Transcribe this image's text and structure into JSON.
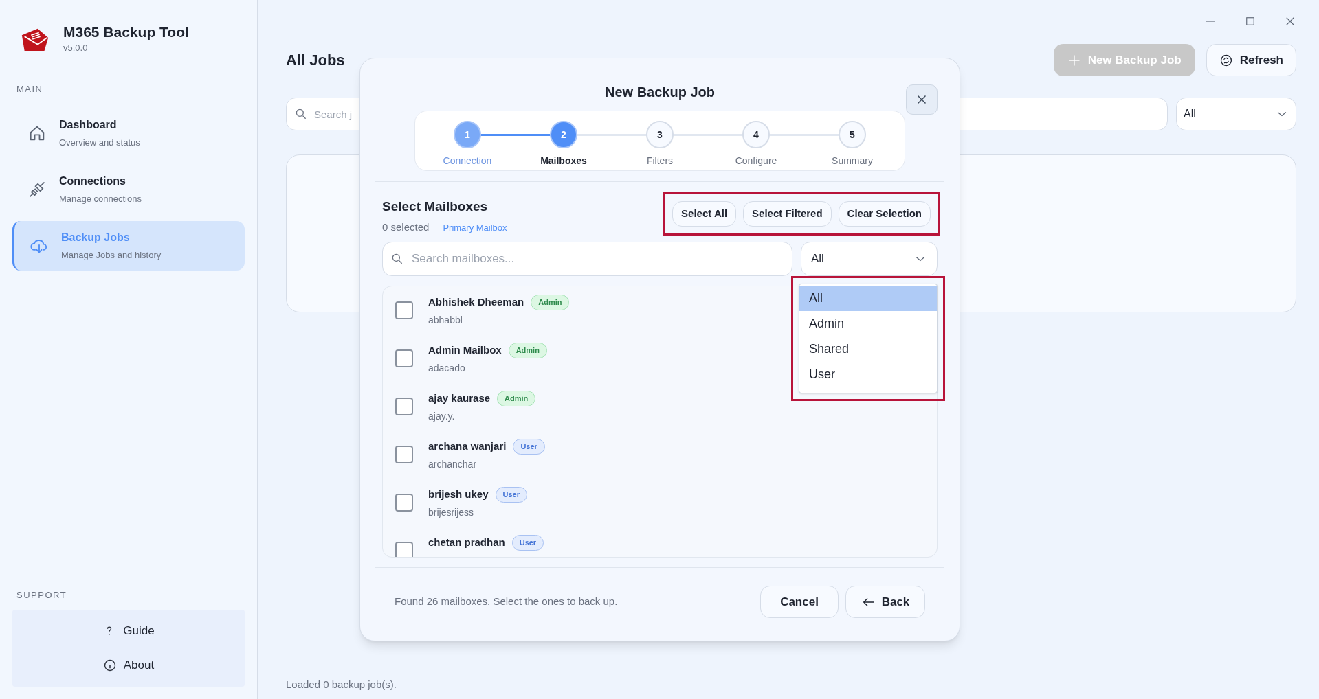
{
  "app": {
    "title": "M365 Backup Tool",
    "version": "v5.0.0"
  },
  "sidebar": {
    "section_main": "MAIN",
    "items": [
      {
        "label": "Dashboard",
        "subtitle": "Overview and status",
        "selected": false
      },
      {
        "label": "Connections",
        "subtitle": "Manage connections",
        "selected": false
      },
      {
        "label": "Backup Jobs",
        "subtitle": "Manage Jobs and history",
        "selected": true
      }
    ],
    "section_support": "SUPPORT",
    "support_items": [
      {
        "label": "Guide"
      },
      {
        "label": "About"
      }
    ]
  },
  "main": {
    "title": "All Jobs",
    "new_button": {
      "label": "New Backup Job",
      "disabled": true
    },
    "refresh_button": "Refresh",
    "search": {
      "placeholder": "Search j"
    },
    "filter": {
      "value": "All"
    },
    "status": "Loaded 0 backup job(s)."
  },
  "modal": {
    "title": "New Backup Job",
    "steps": [
      {
        "number": "1",
        "label": "Connection",
        "completed": true,
        "selected": false
      },
      {
        "number": "2",
        "label": "Mailboxes",
        "completed": false,
        "selected": true
      },
      {
        "number": "3",
        "label": "Filters",
        "completed": false,
        "selected": false
      },
      {
        "number": "4",
        "label": "Configure",
        "completed": false,
        "selected": false
      },
      {
        "number": "5",
        "label": "Summary",
        "completed": false,
        "selected": false
      }
    ],
    "section_title": "Select Mailboxes",
    "selected_count": "0 selected",
    "legend": "Primary Mailbox",
    "actions": {
      "highlighted": true,
      "buttons": [
        "Select All",
        "Select Filtered",
        "Clear Selection"
      ]
    },
    "search": {
      "placeholder": "Search mailboxes..."
    },
    "filter": {
      "value": "All",
      "expanded": true,
      "highlighted": true,
      "options": [
        {
          "label": "All",
          "selected": true
        },
        {
          "label": "Admin",
          "selected": false
        },
        {
          "label": "Shared",
          "selected": false
        },
        {
          "label": "User",
          "selected": false
        }
      ]
    },
    "mailboxes": [
      {
        "name": "Abhishek Dheeman",
        "role": "Admin",
        "email": "abhabbl",
        "checked": false
      },
      {
        "name": "Admin Mailbox",
        "role": "Admin",
        "email": "adacado",
        "checked": false
      },
      {
        "name": "ajay kaurase",
        "role": "Admin",
        "email": "ajay.y.",
        "checked": false
      },
      {
        "name": "archana wanjari",
        "role": "User",
        "email": "archanchar",
        "checked": false
      },
      {
        "name": "brijesh ukey",
        "role": "User",
        "email": "brijesrijess",
        "checked": false
      },
      {
        "name": "chetan pradhan",
        "role": "User",
        "checked": false
      }
    ],
    "footer_text": "Found 26 mailboxes. Select the ones to back up.",
    "cancel_button": "Cancel",
    "back_button": "Back"
  }
}
